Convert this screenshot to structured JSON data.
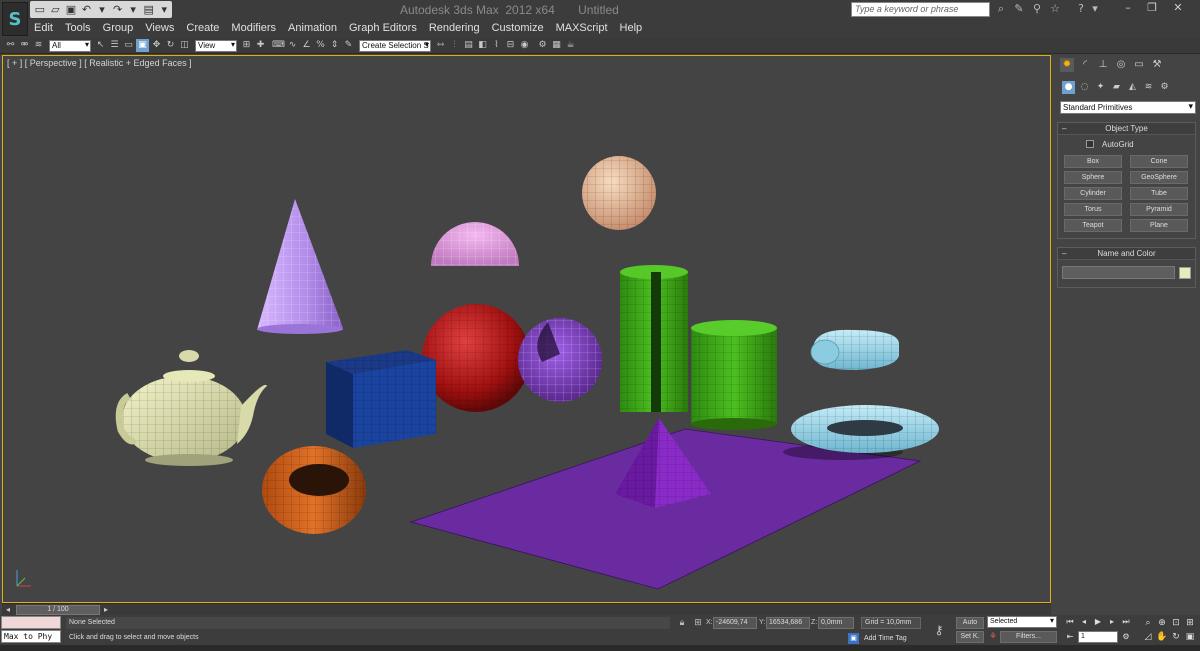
{
  "window": {
    "title": "Autodesk 3ds Max  2012 x64       Untitled",
    "search_placeholder": "Type a keyword or phrase",
    "logo_glyph": "S"
  },
  "quick_access": {
    "icons": [
      "new-file-icon",
      "open-file-icon",
      "save-icon",
      "undo-icon",
      "undo-dropdown-icon",
      "redo-icon",
      "redo-dropdown-icon",
      "project-folder-icon",
      "customize-dropdown-icon"
    ],
    "glyphs": [
      "▭",
      "▱",
      "▣",
      "↶",
      "▾",
      "↷",
      "▾",
      "▤",
      "▾"
    ]
  },
  "menu": {
    "items": [
      "Edit",
      "Tools",
      "Group",
      "Views",
      "Create",
      "Modifiers",
      "Animation",
      "Graph Editors",
      "Rendering",
      "Customize",
      "MAXScript",
      "Help"
    ]
  },
  "toolbar": {
    "selection_filter": "All",
    "reference_coord": "View",
    "named_selection": "Create Selection S"
  },
  "viewport": {
    "label": "[ + ] [ Perspective ] [ Realistic + Edged Faces ]"
  },
  "command_panel": {
    "category": "Standard Primitives",
    "object_type_title": "Object Type",
    "autogrid_label": "AutoGrid",
    "object_buttons": [
      "Box",
      "Cone",
      "Sphere",
      "GeoSphere",
      "Cylinder",
      "Tube",
      "Torus",
      "Pyramid",
      "Teapot",
      "Plane"
    ],
    "name_color_title": "Name and Color",
    "name_value": "",
    "swatch_color": "#e2efb8",
    "collapse_glyph": "–"
  },
  "time_slider": {
    "position": "1 / 100"
  },
  "status": {
    "maxscript_text": "Max to Phy",
    "selection": "None Selected",
    "prompt": "Click and drag to select and move objects",
    "x_label": "X:",
    "x_value": "-24609,74",
    "y_label": "Y:",
    "y_value": "16534,686",
    "z_label": "Z:",
    "z_value": "0,0mm",
    "grid": "Grid = 10,0mm",
    "add_time_tag": "Add Time Tag",
    "auto_key": "Auto",
    "set_key": "Set K.",
    "key_mode": "Selected",
    "filters": "Filters...",
    "frame": "1"
  },
  "colors": {
    "viewport_bg": "#444444",
    "active_border": "#e0b010",
    "accent_blue": "#6fa0d0"
  }
}
